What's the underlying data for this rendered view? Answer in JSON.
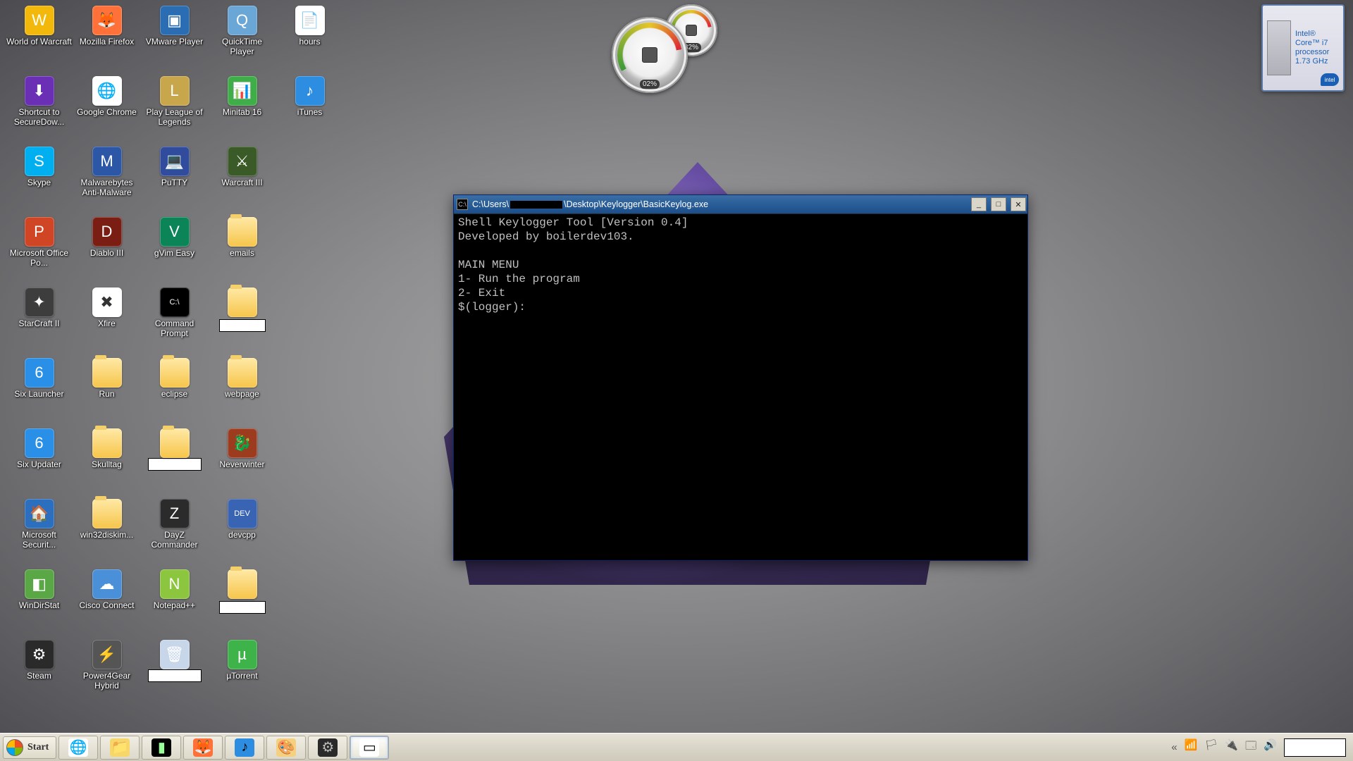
{
  "desktop_icons": [
    {
      "row": 0,
      "col": 0,
      "label": "World of Warcraft",
      "bg": "#f2b90c",
      "glyph": "W"
    },
    {
      "row": 0,
      "col": 1,
      "label": "Mozilla Firefox",
      "bg": "#ff7139",
      "glyph": "🦊"
    },
    {
      "row": 0,
      "col": 2,
      "label": "VMware Player",
      "bg": "#2b6db2",
      "glyph": "▣"
    },
    {
      "row": 0,
      "col": 3,
      "label": "QuickTime Player",
      "bg": "#6aa6d6",
      "glyph": "Q"
    },
    {
      "row": 0,
      "col": 4,
      "label": "hours",
      "bg": "#ffffff",
      "glyph": "📄",
      "fold": false
    },
    {
      "row": 1,
      "col": 0,
      "label": "Shortcut to SecureDow...",
      "bg": "#6a2fb5",
      "glyph": "⬇"
    },
    {
      "row": 1,
      "col": 1,
      "label": "Google Chrome",
      "bg": "#ffffff",
      "glyph": "🌐"
    },
    {
      "row": 1,
      "col": 2,
      "label": "Play League of Legends",
      "bg": "#c8a64b",
      "glyph": "L"
    },
    {
      "row": 1,
      "col": 3,
      "label": "Minitab 16",
      "bg": "#3fae49",
      "glyph": "📊"
    },
    {
      "row": 1,
      "col": 4,
      "label": "iTunes",
      "bg": "#2d8de1",
      "glyph": "♪"
    },
    {
      "row": 2,
      "col": 0,
      "label": "Skype",
      "bg": "#00aff0",
      "glyph": "S"
    },
    {
      "row": 2,
      "col": 1,
      "label": "Malwarebytes Anti-Malware",
      "bg": "#2b57a6",
      "glyph": "M"
    },
    {
      "row": 2,
      "col": 2,
      "label": "PuTTY",
      "bg": "#314c9c",
      "glyph": "💻"
    },
    {
      "row": 2,
      "col": 3,
      "label": "Warcraft III",
      "bg": "#3a5a27",
      "glyph": "⚔"
    },
    {
      "row": 3,
      "col": 0,
      "label": "Microsoft Office Po...",
      "bg": "#d04524",
      "glyph": "P"
    },
    {
      "row": 3,
      "col": 1,
      "label": "Diablo III",
      "bg": "#7a1d12",
      "glyph": "D"
    },
    {
      "row": 3,
      "col": 2,
      "label": "gVim Easy",
      "bg": "#0b8457",
      "glyph": "V"
    },
    {
      "row": 3,
      "col": 3,
      "label": "emails",
      "fold": true
    },
    {
      "row": 4,
      "col": 0,
      "label": "StarCraft II",
      "bg": "#3d3d3d",
      "glyph": "✦"
    },
    {
      "row": 4,
      "col": 1,
      "label": "Xfire",
      "bg": "#ffffff",
      "glyph": "✖"
    },
    {
      "row": 4,
      "col": 2,
      "label": "Command Prompt",
      "bg": "#000000",
      "glyph": "C:\\"
    },
    {
      "row": 4,
      "col": 3,
      "label": "",
      "fold": true,
      "redact": true
    },
    {
      "row": 5,
      "col": 0,
      "label": "Six Launcher",
      "bg": "#2a8fe6",
      "glyph": "6"
    },
    {
      "row": 5,
      "col": 1,
      "label": "Run",
      "fold": true
    },
    {
      "row": 5,
      "col": 2,
      "label": "eclipse",
      "fold": true
    },
    {
      "row": 5,
      "col": 3,
      "label": "webpage",
      "fold": true
    },
    {
      "row": 6,
      "col": 0,
      "label": "Six Updater",
      "bg": "#2a8fe6",
      "glyph": "6"
    },
    {
      "row": 6,
      "col": 1,
      "label": "Skulltag",
      "fold": true
    },
    {
      "row": 6,
      "col": 2,
      "label": "",
      "fold": true,
      "redact": true,
      "wide": true
    },
    {
      "row": 6,
      "col": 3,
      "label": "Neverwinter",
      "bg": "#9c3b1e",
      "glyph": "🐉"
    },
    {
      "row": 7,
      "col": 0,
      "label": "Microsoft Securit...",
      "bg": "#2d6fbf",
      "glyph": "🏠"
    },
    {
      "row": 7,
      "col": 1,
      "label": "win32diskim...",
      "fold": true
    },
    {
      "row": 7,
      "col": 2,
      "label": "DayZ Commander",
      "bg": "#2b2b2b",
      "glyph": "Z"
    },
    {
      "row": 7,
      "col": 3,
      "label": "devcpp",
      "bg": "#3963b3",
      "glyph": "DEV"
    },
    {
      "row": 8,
      "col": 0,
      "label": "WinDirStat",
      "bg": "#5aa845",
      "glyph": "◧"
    },
    {
      "row": 8,
      "col": 1,
      "label": "Cisco Connect",
      "bg": "#4a90d9",
      "glyph": "☁"
    },
    {
      "row": 8,
      "col": 2,
      "label": "Notepad++",
      "bg": "#8cc63f",
      "glyph": "N"
    },
    {
      "row": 8,
      "col": 3,
      "label": "",
      "fold": true,
      "redact": true
    },
    {
      "row": 9,
      "col": 0,
      "label": "Steam",
      "bg": "#2a2a2a",
      "glyph": "⚙"
    },
    {
      "row": 9,
      "col": 1,
      "label": "Power4Gear Hybrid",
      "bg": "#555555",
      "glyph": "⚡"
    },
    {
      "row": 9,
      "col": 2,
      "label": "",
      "bg": "#c7d6e8",
      "glyph": "🗑",
      "redact2": true
    },
    {
      "row": 9,
      "col": 3,
      "label": "µTorrent",
      "bg": "#3eb34a",
      "glyph": "µ"
    }
  ],
  "gauges": {
    "big_reading": "02%",
    "small_reading": "32%"
  },
  "cpu_badge": {
    "line1": "Intel®",
    "line2": "Core™ i7",
    "line3": "processor",
    "line4": "1.73 GHz",
    "logo": "intel"
  },
  "cmd_window": {
    "title_prefix": "C:\\Users\\",
    "title_suffix": "\\Desktop\\Keylogger\\BasicKeylog.exe",
    "lines": [
      "Shell Keylogger Tool [Version 0.4]",
      "Developed by boilerdev103.",
      "",
      "MAIN MENU",
      "1- Run the program",
      "2- Exit",
      "$(logger):"
    ],
    "btn_min": "_",
    "btn_max": "□",
    "btn_close": "✕"
  },
  "taskbar": {
    "start_label": "Start",
    "buttons": [
      {
        "name": "chrome",
        "glyph": "🌐",
        "bg": "#fff"
      },
      {
        "name": "explorer",
        "glyph": "📁",
        "bg": "#f7d66a"
      },
      {
        "name": "cmd",
        "glyph": "▮",
        "bg": "#000",
        "color": "#9f9"
      },
      {
        "name": "firefox",
        "glyph": "🦊",
        "bg": "#ff7139"
      },
      {
        "name": "itunes",
        "glyph": "♪",
        "bg": "#2d8de1"
      },
      {
        "name": "paint",
        "glyph": "🎨",
        "bg": "#f5d080"
      },
      {
        "name": "steam",
        "glyph": "⚙",
        "bg": "#2a2a2a",
        "color": "#bbb"
      },
      {
        "name": "console-active",
        "glyph": "▭",
        "bg": "#fff",
        "active": true
      }
    ],
    "tray": {
      "chevron": "«",
      "icons": [
        "📶",
        "🏳",
        "🔌",
        "🗔",
        "🔊"
      ]
    }
  }
}
